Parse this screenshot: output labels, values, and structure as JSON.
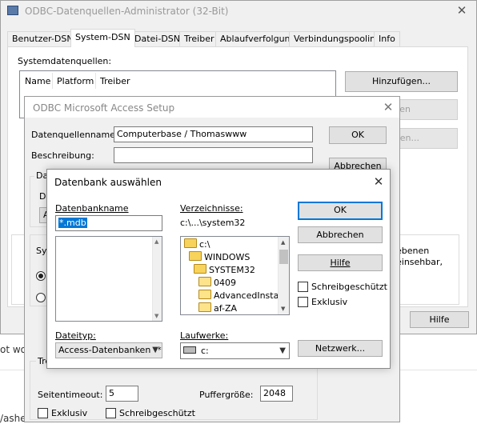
{
  "main_window": {
    "title": "ODBC-Datenquellen-Administrator (32-Bit)",
    "tabs": [
      "Benutzer-DSN",
      "System-DSN",
      "Datei-DSN",
      "Treiber",
      "Ablaufverfolgung",
      "Verbindungspooling",
      "Info"
    ],
    "active_tab": "System-DSN",
    "section_label": "Systemdatenquellen:",
    "columns": [
      "Name",
      "Platform",
      "Treiber"
    ],
    "add_button": "Hinzufügen...",
    "remove_button_partial": "emen",
    "configure_button_partial": "rieren...",
    "info_text_1": "ebenen",
    "info_text_2": "einsehbar,",
    "help_button": "Hilfe"
  },
  "background": {
    "text1": "ot wo",
    "text2": "/ashe"
  },
  "access_setup": {
    "title": "ODBC Microsoft Access Setup",
    "dsn_label": "Datenquellenname:",
    "dsn_value": "Computerbase / Thomaswww",
    "desc_label": "Beschreibung:",
    "desc_value": "",
    "ok_button": "OK",
    "cancel_button": "Abbrechen",
    "partial_group1": "Dat",
    "partial_label": "De",
    "partial_btn": "A",
    "partial_sys": "Sys",
    "partial_tre": "Tre",
    "timeout_label": "Seitentimeout:",
    "timeout_value": "5",
    "buffer_label": "Puffergröße:",
    "buffer_value": "2048",
    "exclusive_label": "Exklusiv",
    "readonly_label": "Schreibgeschützt"
  },
  "db_select": {
    "title": "Datenbank auswählen",
    "dbname_label": "Datenbankname",
    "dbname_value": "*.mdb",
    "dir_label": "Verzeichnisse:",
    "dir_path": "c:\\...\\system32",
    "dir_items": [
      "c:\\",
      "WINDOWS",
      "SYSTEM32",
      "0409",
      "AdvancedInstalle",
      "af-ZA"
    ],
    "filetype_label": "Dateityp:",
    "filetype_value": "Access-Datenbanken (*",
    "drive_label": "Laufwerke:",
    "drive_value": "c:",
    "ok_button": "OK",
    "cancel_button": "Abbrechen",
    "help_button": "Hilfe",
    "readonly_label": "Schreibgeschützt",
    "exclusive_label": "Exklusiv",
    "network_button": "Netzwerk..."
  },
  "icons": [
    "close-icon",
    "folder-icon",
    "drive-icon",
    "chevron-down-icon"
  ]
}
